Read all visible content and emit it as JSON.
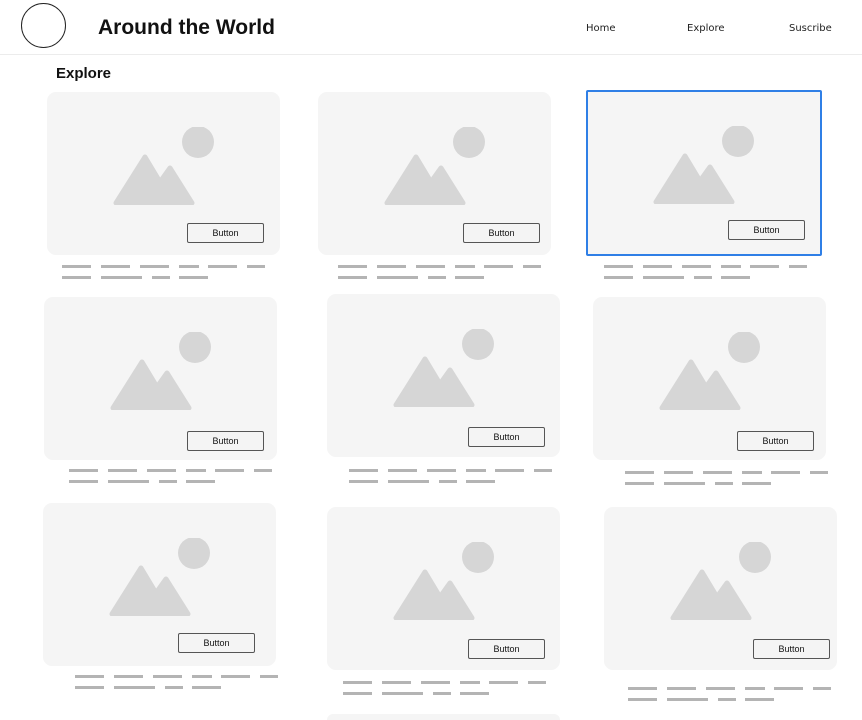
{
  "header": {
    "site_title": "Around the World",
    "nav": [
      {
        "label": "Home"
      },
      {
        "label": "Explore"
      },
      {
        "label": "Suscribe"
      }
    ]
  },
  "main": {
    "section_title": "Explore",
    "cards": [
      {
        "button_label": "Button",
        "selected": false
      },
      {
        "button_label": "Button",
        "selected": false
      },
      {
        "button_label": "Button",
        "selected": true
      },
      {
        "button_label": "Button",
        "selected": false
      },
      {
        "button_label": "Button",
        "selected": false
      },
      {
        "button_label": "Button",
        "selected": false
      },
      {
        "button_label": "Button",
        "selected": false
      },
      {
        "button_label": "Button",
        "selected": false
      },
      {
        "button_label": "Button",
        "selected": false
      }
    ]
  },
  "colors": {
    "placeholder_bg": "#f5f5f5",
    "placeholder_icon": "#d6d6d6",
    "text_line": "#b4b4b4",
    "selection_border": "#2f7fe6"
  }
}
